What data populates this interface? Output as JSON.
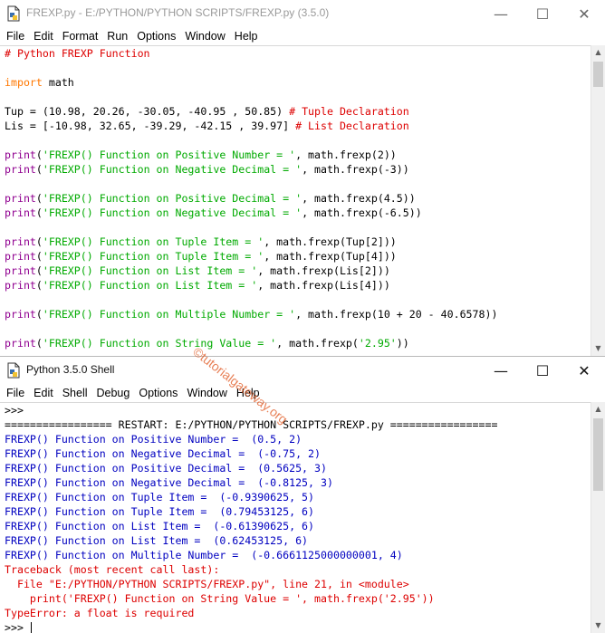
{
  "editor": {
    "title": "FREXP.py - E:/PYTHON/PYTHON SCRIPTS/FREXP.py (3.5.0)",
    "menu": [
      "File",
      "Edit",
      "Format",
      "Run",
      "Options",
      "Window",
      "Help"
    ],
    "lines": [
      "# Python FREXP Function",
      "",
      "import math",
      "",
      "Tup = (10.98, 20.26, -30.05, -40.95 , 50.85) # Tuple Declaration",
      "Lis = [-10.98, 32.65, -39.29, -42.15 , 39.97] # List Declaration",
      "",
      "print('FREXP() Function on Positive Number = ', math.frexp(2))",
      "print('FREXP() Function on Negative Decimal = ', math.frexp(-3))",
      "",
      "print('FREXP() Function on Positive Decimal = ', math.frexp(4.5))",
      "print('FREXP() Function on Negative Decimal = ', math.frexp(-6.5))",
      "",
      "print('FREXP() Function on Tuple Item = ', math.frexp(Tup[2]))",
      "print('FREXP() Function on Tuple Item = ', math.frexp(Tup[4]))",
      "print('FREXP() Function on List Item = ', math.frexp(Lis[2]))",
      "print('FREXP() Function on List Item = ', math.frexp(Lis[4]))",
      "",
      "print('FREXP() Function on Multiple Number = ', math.frexp(10 + 20 - 40.6578))",
      "",
      "print('FREXP() Function on String Value = ', math.frexp('2.95'))"
    ]
  },
  "shell": {
    "title": "Python 3.5.0 Shell",
    "menu": [
      "File",
      "Edit",
      "Shell",
      "Debug",
      "Options",
      "Window",
      "Help"
    ],
    "prompt_top": ">>>",
    "restart": "================= RESTART: E:/PYTHON/PYTHON SCRIPTS/FREXP.py =================",
    "output": [
      "FREXP() Function on Positive Number =  (0.5, 2)",
      "FREXP() Function on Negative Decimal =  (-0.75, 2)",
      "FREXP() Function on Positive Decimal =  (0.5625, 3)",
      "FREXP() Function on Negative Decimal =  (-0.8125, 3)",
      "FREXP() Function on Tuple Item =  (-0.9390625, 5)",
      "FREXP() Function on Tuple Item =  (0.79453125, 6)",
      "FREXP() Function on List Item =  (-0.61390625, 6)",
      "FREXP() Function on List Item =  (0.62453125, 6)",
      "FREXP() Function on Multiple Number =  (-0.6661125000000001, 4)"
    ],
    "traceback": [
      "Traceback (most recent call last):",
      "  File \"E:/PYTHON/PYTHON SCRIPTS/FREXP.py\", line 21, in <module>",
      "    print('FREXP() Function on String Value = ', math.frexp('2.95'))",
      "TypeError: a float is required"
    ],
    "prompt_bottom": ">>> "
  },
  "watermark": "©tutorialgateway.org",
  "colors": {
    "keyword": "#ff7700",
    "string": "#00aa00",
    "comment": "#dd0000",
    "builtin": "#900090",
    "stdout": "#0000c0",
    "stderr": "#dd0000"
  },
  "icons": {
    "app": "idle-file-icon",
    "minimize": "minimize-icon",
    "maximize": "maximize-icon",
    "close": "close-icon"
  }
}
